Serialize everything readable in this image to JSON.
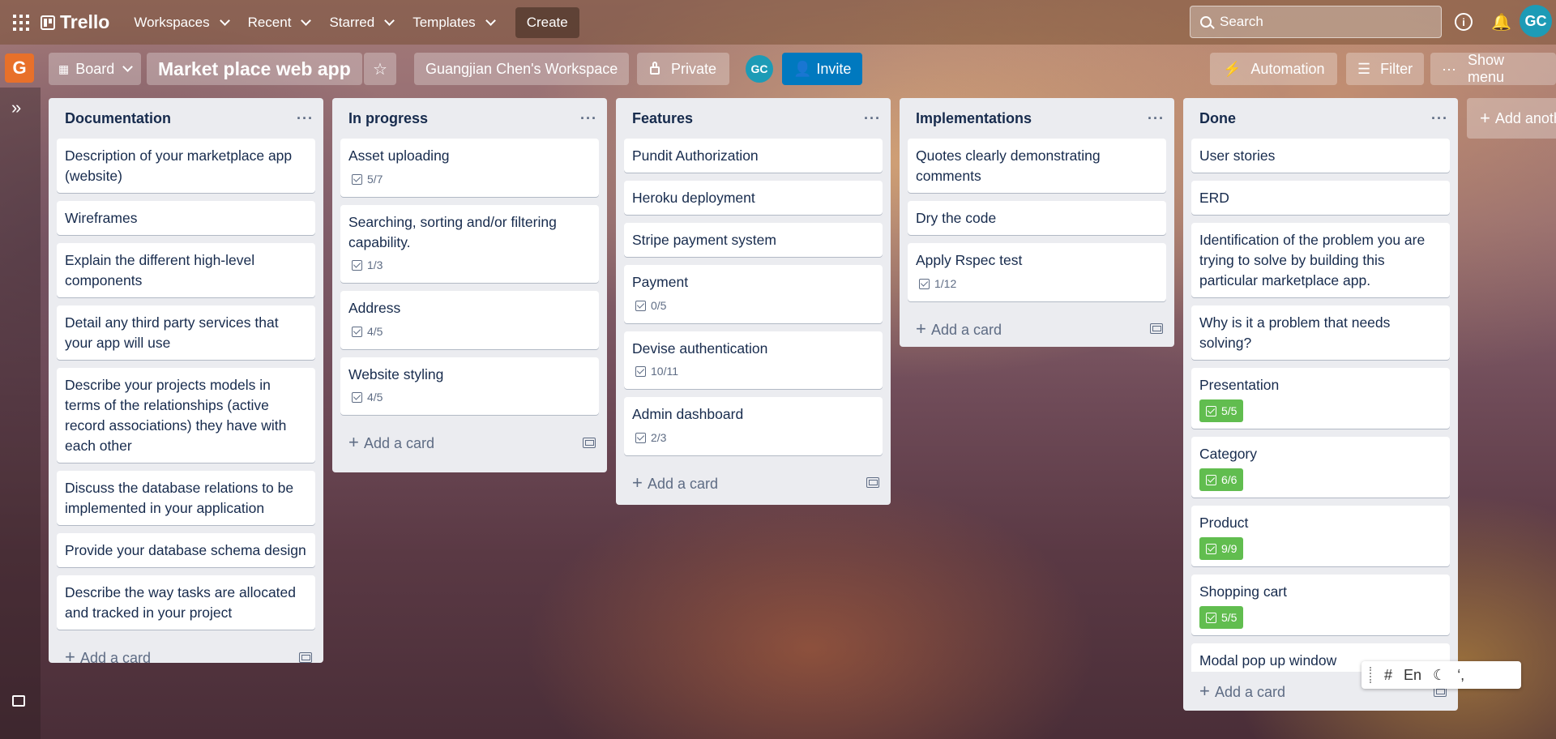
{
  "topbar": {
    "logo": "Trello",
    "nav": [
      "Workspaces",
      "Recent",
      "Starred",
      "Templates"
    ],
    "create": "Create",
    "search_placeholder": "Search",
    "avatar_initials": "GC"
  },
  "board": {
    "workspace_letter": "G",
    "view": "Board",
    "title": "Market place web app",
    "workspace": "Guangjian Chen's Workspace",
    "visibility": "Private",
    "member_initials": "GC",
    "invite": "Invite",
    "automation": "Automation",
    "filter": "Filter",
    "show_menu": "Show menu",
    "add_list": "Add another list"
  },
  "lists": [
    {
      "title": "Documentation",
      "cards": [
        {
          "title": "Description of your marketplace app (website)"
        },
        {
          "title": "Wireframes"
        },
        {
          "title": "Explain the different high-level components"
        },
        {
          "title": "Detail any third party services that your app will use"
        },
        {
          "title": "Describe your projects models in terms of the relationships (active record associations) they have with each other"
        },
        {
          "title": "Discuss the database relations to be implemented in your application"
        },
        {
          "title": "Provide your database schema design"
        },
        {
          "title": "Describe the way tasks are allocated and tracked in your project"
        }
      ]
    },
    {
      "title": "In progress",
      "cards": [
        {
          "title": "Asset uploading",
          "checklist": "5/7"
        },
        {
          "title": "Searching, sorting and/or filtering capability.",
          "checklist": "1/3"
        },
        {
          "title": "Address",
          "checklist": "4/5"
        },
        {
          "title": "Website styling",
          "checklist": "4/5"
        }
      ]
    },
    {
      "title": "Features",
      "cards": [
        {
          "title": "Pundit Authorization"
        },
        {
          "title": "Heroku deployment"
        },
        {
          "title": "Stripe payment system"
        },
        {
          "title": "Payment",
          "checklist": "0/5"
        },
        {
          "title": "Devise authentication",
          "checklist": "10/11"
        },
        {
          "title": "Admin dashboard",
          "checklist": "2/3"
        }
      ]
    },
    {
      "title": "Implementations",
      "cards": [
        {
          "title": "Quotes clearly demonstrating comments"
        },
        {
          "title": "Dry the code"
        },
        {
          "title": "Apply Rspec test",
          "checklist": "1/12"
        }
      ]
    },
    {
      "title": "Done",
      "cards": [
        {
          "title": "User stories"
        },
        {
          "title": "ERD"
        },
        {
          "title": "Identification of the problem you are trying to solve by building this particular marketplace app."
        },
        {
          "title": "Why is it a problem that needs solving?"
        },
        {
          "title": "Presentation",
          "checklist": "5/5",
          "complete": true
        },
        {
          "title": "Category",
          "checklist": "6/6",
          "complete": true
        },
        {
          "title": "Product",
          "checklist": "9/9",
          "complete": true
        },
        {
          "title": "Shopping cart",
          "checklist": "5/5",
          "complete": true
        },
        {
          "title": "Modal pop up window"
        }
      ]
    }
  ],
  "add_card_label": "Add a card",
  "ime": {
    "lang": "En"
  }
}
